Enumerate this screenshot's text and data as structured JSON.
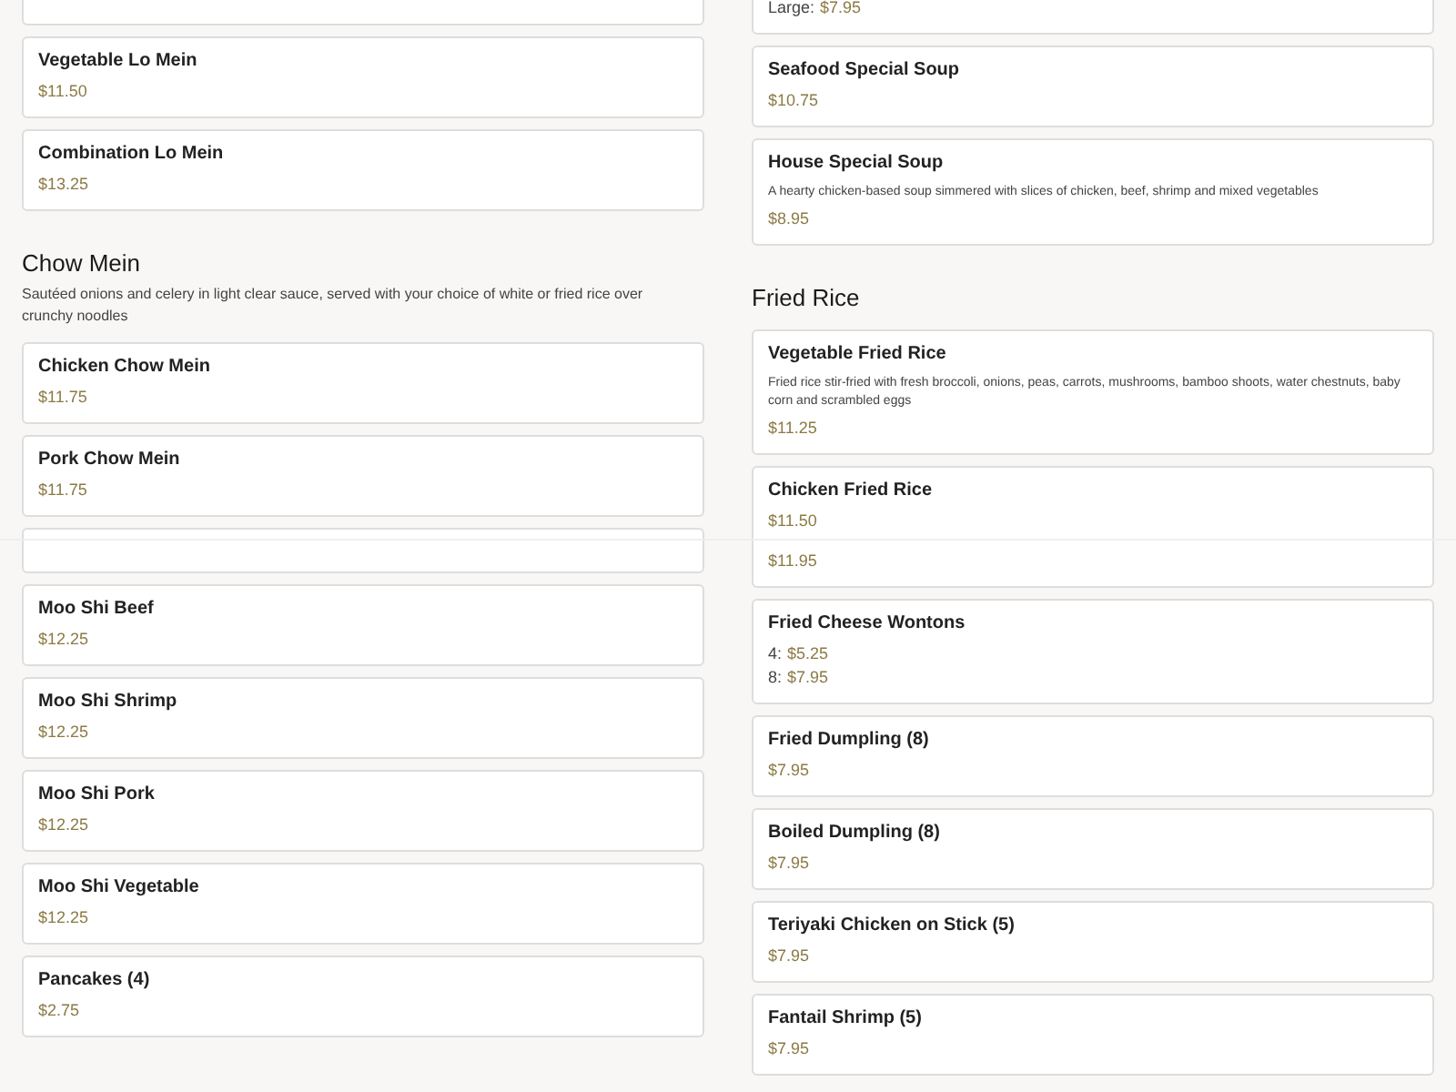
{
  "panes": [
    {
      "columns": [
        [
          {
            "kind": "clipped"
          },
          {
            "kind": "item",
            "name": "Vegetable Lo Mein",
            "prices": [
              {
                "price": "$11.50"
              }
            ]
          },
          {
            "kind": "item",
            "name": "Combination Lo Mein",
            "prices": [
              {
                "price": "$13.25"
              }
            ]
          },
          {
            "kind": "section",
            "title": "Chow Mein",
            "description": "Sautéed onions and celery in light clear sauce, served with your choice of white or fried rice over crunchy noodles"
          },
          {
            "kind": "item",
            "name": "Chicken Chow Mein",
            "prices": [
              {
                "price": "$11.75"
              }
            ]
          },
          {
            "kind": "item",
            "name": "Pork Chow Mein",
            "prices": [
              {
                "price": "$11.75"
              }
            ]
          },
          {
            "kind": "clipped"
          }
        ],
        [
          {
            "kind": "item",
            "prices": [
              {
                "label": "Large:",
                "price": "$7.95"
              }
            ]
          },
          {
            "kind": "item",
            "name": "Seafood Special Soup",
            "prices": [
              {
                "price": "$10.75"
              }
            ]
          },
          {
            "kind": "item",
            "name": "House Special Soup",
            "description": "A hearty chicken-based soup simmered with slices of chicken, beef, shrimp and mixed vegetables",
            "prices": [
              {
                "price": "$8.95"
              }
            ]
          },
          {
            "kind": "section",
            "title": "Fried Rice"
          },
          {
            "kind": "item",
            "name": "Vegetable Fried Rice",
            "description": "Fried rice stir-fried with fresh broccoli, onions, peas, carrots, mushrooms, bamboo shoots, water chestnuts, baby corn and scrambled eggs",
            "prices": [
              {
                "price": "$11.25"
              }
            ]
          },
          {
            "kind": "item",
            "name": "Chicken Fried Rice",
            "prices": [
              {
                "price": "$11.50"
              }
            ]
          }
        ]
      ]
    },
    {
      "columns": [
        [
          {
            "kind": "clipped"
          },
          {
            "kind": "item",
            "name": "Moo Shi Beef",
            "prices": [
              {
                "price": "$12.25"
              }
            ]
          },
          {
            "kind": "item",
            "name": "Moo Shi Shrimp",
            "prices": [
              {
                "price": "$12.25"
              }
            ]
          },
          {
            "kind": "item",
            "name": "Moo Shi Pork",
            "prices": [
              {
                "price": "$12.25"
              }
            ]
          },
          {
            "kind": "item",
            "name": "Moo Shi Vegetable",
            "prices": [
              {
                "price": "$12.25"
              }
            ]
          },
          {
            "kind": "item",
            "name": "Pancakes (4)",
            "prices": [
              {
                "price": "$2.75"
              }
            ]
          }
        ],
        [
          {
            "kind": "item",
            "prices": [
              {
                "price": "$11.95"
              }
            ]
          },
          {
            "kind": "item",
            "name": "Fried Cheese Wontons",
            "prices": [
              {
                "label": "4:",
                "price": "$5.25"
              },
              {
                "label": "8:",
                "price": "$7.95"
              }
            ]
          },
          {
            "kind": "item",
            "name": "Fried Dumpling (8)",
            "prices": [
              {
                "price": "$7.95"
              }
            ]
          },
          {
            "kind": "item",
            "name": "Boiled Dumpling (8)",
            "prices": [
              {
                "price": "$7.95"
              }
            ]
          },
          {
            "kind": "item",
            "name": "Teriyaki Chicken on Stick (5)",
            "prices": [
              {
                "price": "$7.95"
              }
            ]
          },
          {
            "kind": "item",
            "name": "Fantail Shrimp (5)",
            "prices": [
              {
                "price": "$7.95"
              }
            ]
          }
        ]
      ]
    }
  ]
}
